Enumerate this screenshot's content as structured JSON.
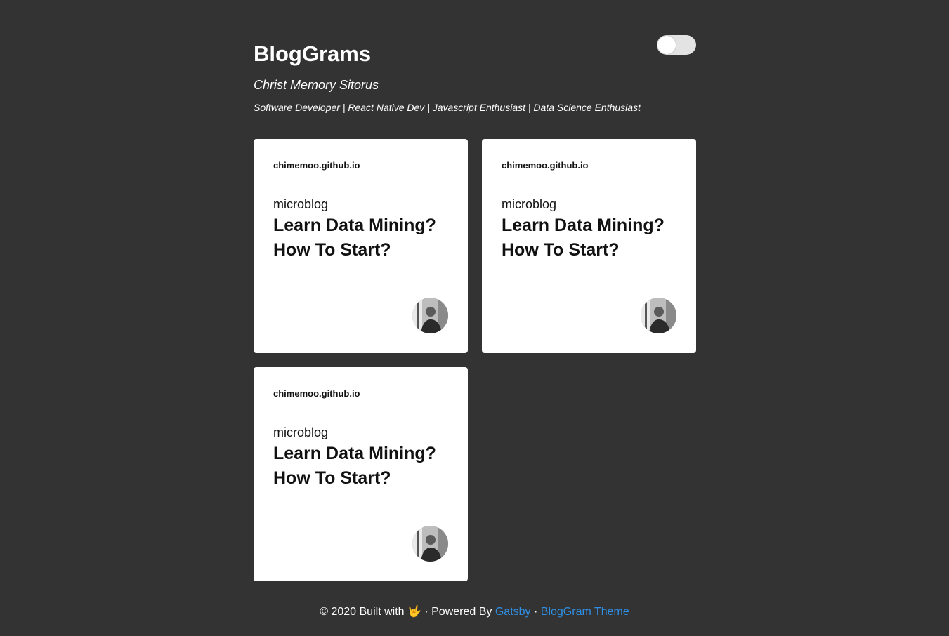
{
  "header": {
    "site_title": "BlogGrams",
    "author_name": "Christ Memory Sitorus",
    "author_bio": "Software Developer | React Native Dev | Javascript Enthusiast | Data Science Enthusiast",
    "toggle_state": "off"
  },
  "cards": [
    {
      "site": "chimemoo.github.io",
      "tag": "microblog",
      "title": "Learn Data Mining? How To Start?",
      "avatar_icon": "author-avatar"
    },
    {
      "site": "chimemoo.github.io",
      "tag": "microblog",
      "title": "Learn Data Mining? How To Start?",
      "avatar_icon": "author-avatar"
    },
    {
      "site": "chimemoo.github.io",
      "tag": "microblog",
      "title": "Learn Data Mining? How To Start?",
      "avatar_icon": "author-avatar"
    }
  ],
  "footer": {
    "prefix": "© 2020 Built with",
    "emoji": "🤟",
    "powered": "· Powered By",
    "gatsby_link": "Gatsby",
    "separator": "·",
    "theme_link": "BlogGram Theme"
  },
  "colors": {
    "background": "#333333",
    "card": "#ffffff",
    "link": "#2f8fe5",
    "toggle_track": "#e3e3e3"
  }
}
